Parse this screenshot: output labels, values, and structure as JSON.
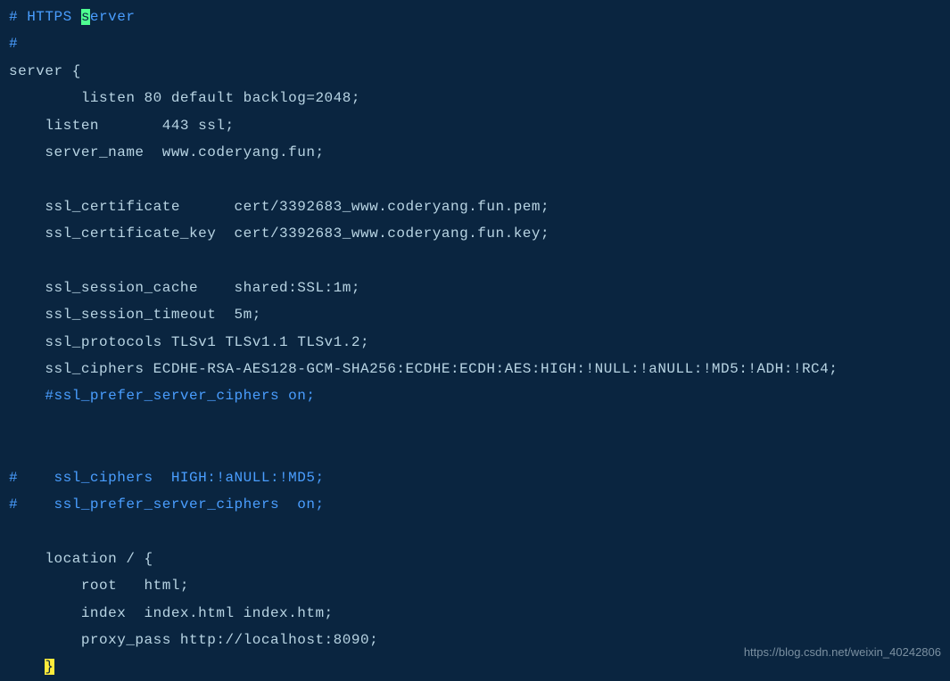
{
  "code": {
    "line1_comment_pre": "# HTTPS ",
    "line1_cursor": "s",
    "line1_comment_post": "erver",
    "line2_comment": "#",
    "line3": "server {",
    "line4": "        listen 80 default backlog=2048;",
    "line5": "    listen       443 ssl;",
    "line6": "    server_name  www.coderyang.fun;",
    "line7": "",
    "line8": "    ssl_certificate      cert/3392683_www.coderyang.fun.pem;",
    "line9": "    ssl_certificate_key  cert/3392683_www.coderyang.fun.key;",
    "line10": "",
    "line11": "    ssl_session_cache    shared:SSL:1m;",
    "line12": "    ssl_session_timeout  5m;",
    "line13": "    ssl_protocols TLSv1 TLSv1.1 TLSv1.2;",
    "line14": "    ssl_ciphers ECDHE-RSA-AES128-GCM-SHA256:ECDHE:ECDH:AES:HIGH:!NULL:!aNULL:!MD5:!ADH:!RC4;",
    "line15_indent": "    ",
    "line15_comment": "#ssl_prefer_server_ciphers on;",
    "line16": "",
    "line17": "",
    "line18_comment": "#    ssl_ciphers  HIGH:!aNULL:!MD5;",
    "line19_comment": "#    ssl_prefer_server_ciphers  on;",
    "line20": "",
    "line21": "    location / {",
    "line22": "        root   html;",
    "line23": "        index  index.html index.htm;",
    "line24": "        proxy_pass http://localhost:8090;",
    "line25_indent": "    ",
    "line25_brace": "}"
  },
  "watermark": "https://blog.csdn.net/weixin_40242806"
}
